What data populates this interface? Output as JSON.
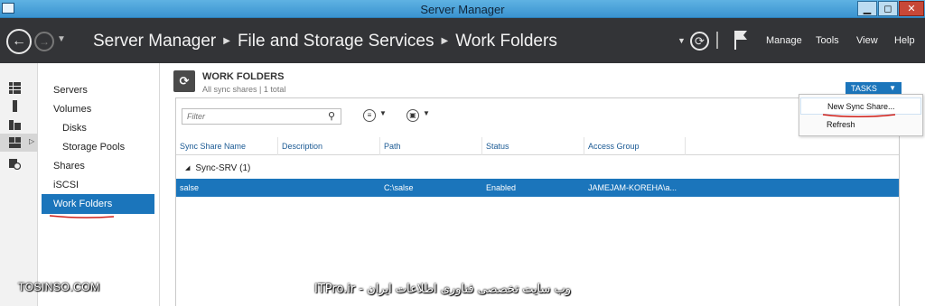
{
  "window": {
    "title": "Server Manager",
    "controls": {
      "minimize": "▁",
      "maximize": "◻",
      "close": "✕"
    }
  },
  "header": {
    "breadcrumb": [
      "Server Manager",
      "File and Storage Services",
      "Work Folders"
    ],
    "menu": [
      "Manage",
      "Tools",
      "View",
      "Help"
    ]
  },
  "rail": {
    "icons": [
      "dashboard-icon",
      "local-server-icon",
      "all-servers-icon",
      "file-storage-icon",
      "iis-icon"
    ]
  },
  "nav": {
    "items": [
      {
        "label": "Servers",
        "level": 0
      },
      {
        "label": "Volumes",
        "level": 0
      },
      {
        "label": "Disks",
        "level": 1
      },
      {
        "label": "Storage Pools",
        "level": 1
      },
      {
        "label": "Shares",
        "level": 0
      },
      {
        "label": "iSCSI",
        "level": 0
      },
      {
        "label": "Work Folders",
        "level": 0,
        "active": true
      }
    ]
  },
  "main": {
    "title": "WORK FOLDERS",
    "subtitle": "All sync shares | 1 total",
    "tasks_label": "TASKS",
    "filter_placeholder": "Filter",
    "columns": [
      "Sync Share Name",
      "Description",
      "Path",
      "Status",
      "Access Group"
    ],
    "group": "Sync-SRV (1)",
    "rows": [
      {
        "name": "salse",
        "description": "",
        "path": "C:\\salse",
        "status": "Enabled",
        "access_group": "JAMEJAM-KOREHA\\a..."
      }
    ]
  },
  "tasks_menu": {
    "items": [
      "New Sync Share...",
      "Refresh"
    ]
  },
  "watermarks": {
    "left": "TOSINSO.COM",
    "right": "ITPro.ir - وب سایت تخصصی فناوری اطلاعات ایران"
  },
  "colors": {
    "accent": "#1b75bb",
    "header_bg": "#333437",
    "annotation_red": "#d0201a"
  }
}
